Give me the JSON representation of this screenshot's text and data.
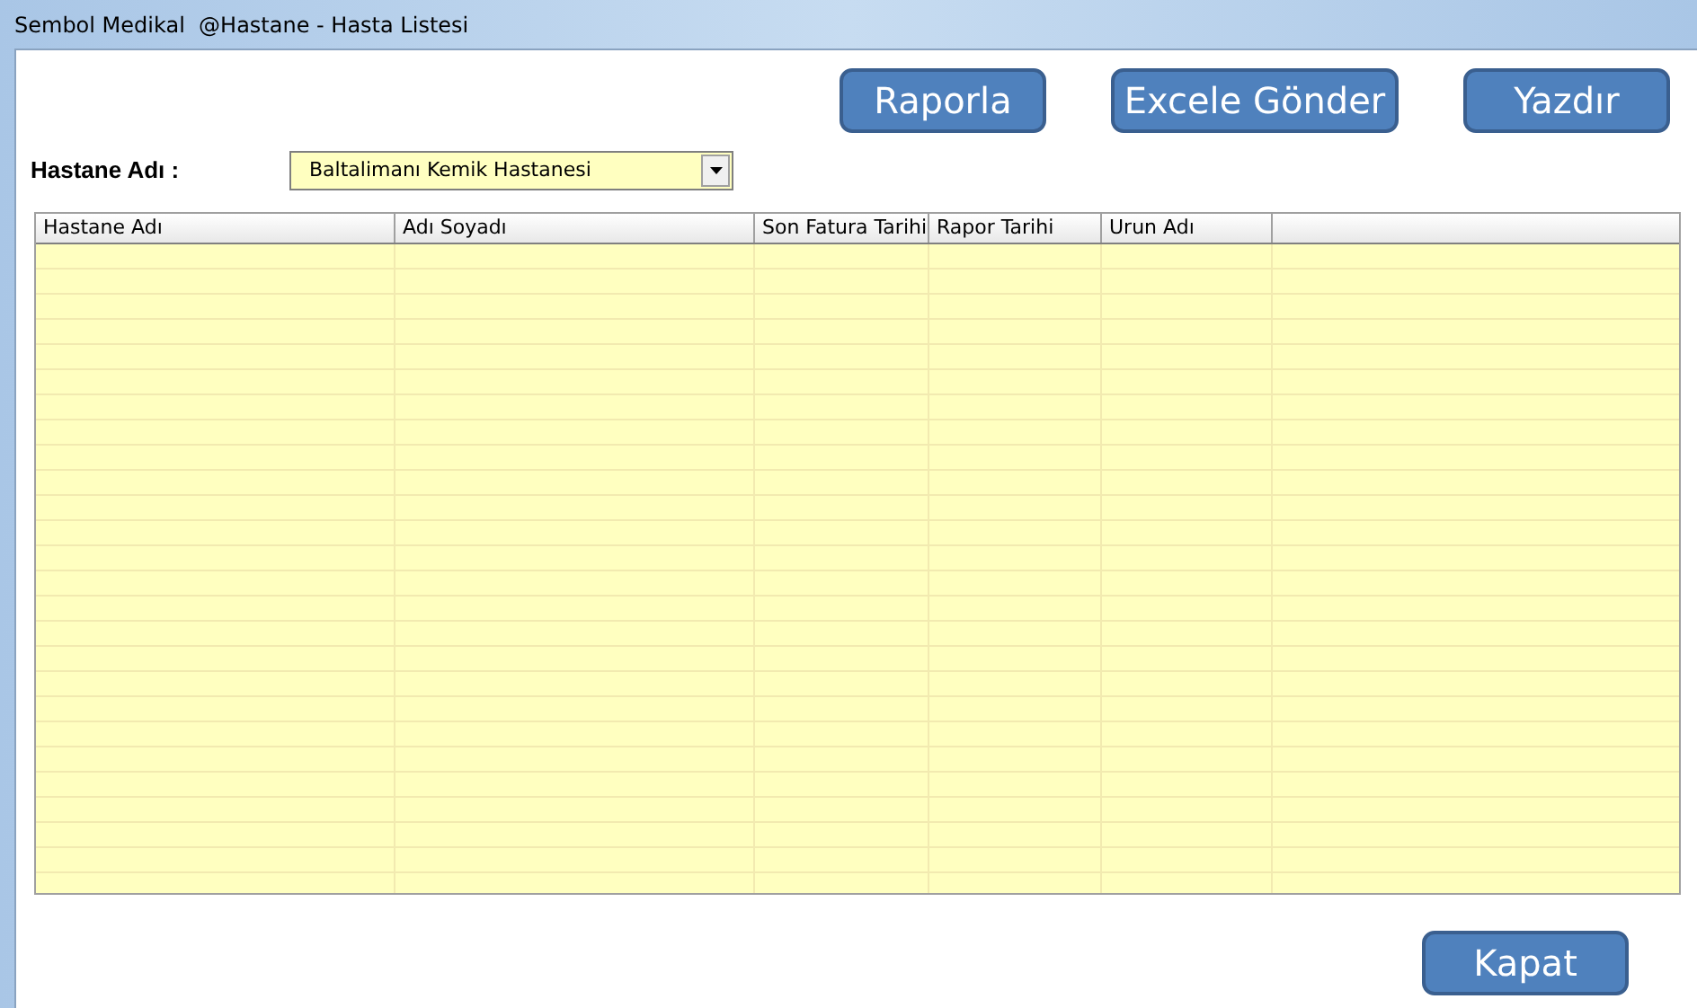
{
  "window": {
    "title": "Sembol Medikal  @Hastane - Hasta Listesi"
  },
  "toolbar_buttons": [
    "Raporla",
    "Excele Gönder",
    "Yazdır"
  ],
  "hospital_field": {
    "label": "Hastane Adı :",
    "value": "Baltalimanı Kemik Hastanesi"
  },
  "table": {
    "columns": [
      "Hastane Adı",
      "Adı Soyadı",
      "Son Fatura Tarihi",
      "Rapor Tarihi",
      "Urun Adı"
    ]
  },
  "close_button": "Kapat"
}
